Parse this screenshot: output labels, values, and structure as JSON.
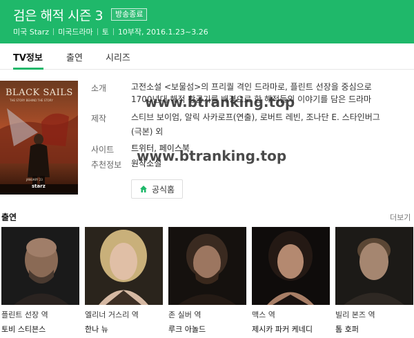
{
  "header": {
    "title": "검은 해적 시즌 3",
    "badge": "방송종료",
    "meta": [
      "미국 Starz",
      "미국드라마",
      "토",
      "10부작, 2016.1.23~3.26"
    ]
  },
  "tabs": [
    {
      "label": "TV정보",
      "active": true
    },
    {
      "label": "출연",
      "active": false
    },
    {
      "label": "시리즈",
      "active": false
    }
  ],
  "poster": {
    "title_text": "BLACK SAILS",
    "subtitle_text": "THE STORY BEHIND THE STORY",
    "date_text": "JANUARY 23",
    "brand_text": "starz"
  },
  "info": {
    "intro_label": "소개",
    "intro_line1": "고전소설 <보물섬>의 프리퀄 격인 드라마로, 플린트 선장을 중심으로",
    "intro_line2": "1700년대 해적 황금기를 배경으로 한 해적들의 이야기를 담은 드라마",
    "producer_label": "제작",
    "producer_line1": "스티브 보이엄, 알릭 사카로프(연출), 로버트 레빈, 조나단 E. 스타인버그",
    "producer_line2": "(극본) 외",
    "site_label": "사이트",
    "site_value": "트위터, 페이스북",
    "rec_label": "추천정보",
    "rec_value": "원작소설",
    "home_button": "공식홈"
  },
  "watermark": "www.btranking.top",
  "cast_section": {
    "title": "출연",
    "more": "더보기",
    "members": [
      {
        "role": "플린트 선장 역",
        "actor": "토비 스티븐스"
      },
      {
        "role": "엘리너 거스리 역",
        "actor": "한나 뉴"
      },
      {
        "role": "존 실버 역",
        "actor": "루크 아놀드"
      },
      {
        "role": "맥스 역",
        "actor": "제시카 파커 케네디"
      },
      {
        "role": "빌리 본즈 역",
        "actor": "톰 호퍼"
      }
    ]
  },
  "colors": {
    "brand_green": "#1fb86a"
  }
}
